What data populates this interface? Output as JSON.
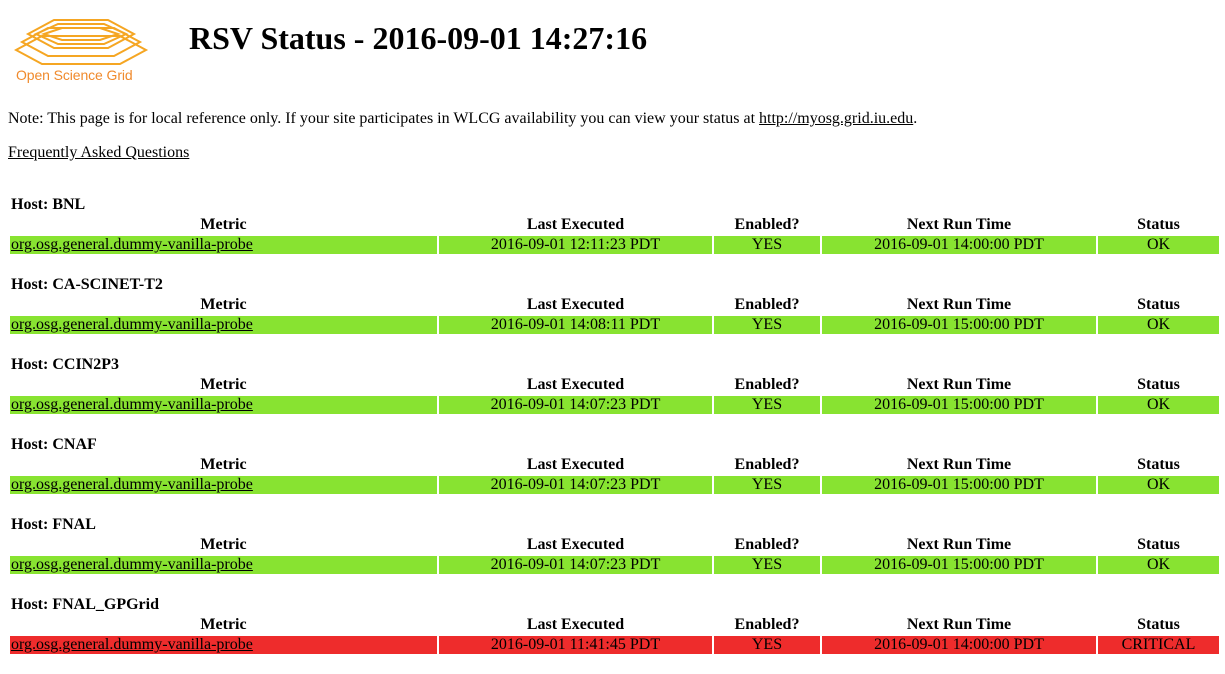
{
  "logo": {
    "text": "Open Science Grid",
    "color": "#f08a2c"
  },
  "page": {
    "title": "RSV Status - 2016-09-01 14:27:16"
  },
  "note": {
    "prefix": "Note: This page is for local reference only. If your site participates in WLCG availability you can view your status at ",
    "link_text": "http://myosg.grid.iu.edu",
    "suffix": "."
  },
  "faq": {
    "link_text": "Frequently Asked Questions"
  },
  "table_headers": {
    "metric": "Metric",
    "last_executed": "Last Executed",
    "enabled": "Enabled?",
    "next_run": "Next Run Time",
    "status": "Status"
  },
  "status_colors": {
    "OK": "#88e331",
    "CRITICAL": "#ee2c2c"
  },
  "hosts": [
    {
      "label": "Host: BNL",
      "metric": "org.osg.general.dummy-vanilla-probe",
      "last_executed": "2016-09-01 12:11:23 PDT",
      "enabled": "YES",
      "next_run": "2016-09-01 14:00:00 PDT",
      "status": "OK"
    },
    {
      "label": "Host: CA-SCINET-T2",
      "metric": "org.osg.general.dummy-vanilla-probe",
      "last_executed": "2016-09-01 14:08:11 PDT",
      "enabled": "YES",
      "next_run": "2016-09-01 15:00:00 PDT",
      "status": "OK"
    },
    {
      "label": "Host: CCIN2P3",
      "metric": "org.osg.general.dummy-vanilla-probe",
      "last_executed": "2016-09-01 14:07:23 PDT",
      "enabled": "YES",
      "next_run": "2016-09-01 15:00:00 PDT",
      "status": "OK"
    },
    {
      "label": "Host: CNAF",
      "metric": "org.osg.general.dummy-vanilla-probe",
      "last_executed": "2016-09-01 14:07:23 PDT",
      "enabled": "YES",
      "next_run": "2016-09-01 15:00:00 PDT",
      "status": "OK"
    },
    {
      "label": "Host: FNAL",
      "metric": "org.osg.general.dummy-vanilla-probe",
      "last_executed": "2016-09-01 14:07:23 PDT",
      "enabled": "YES",
      "next_run": "2016-09-01 15:00:00 PDT",
      "status": "OK"
    },
    {
      "label": "Host: FNAL_GPGrid",
      "metric": "org.osg.general.dummy-vanilla-probe",
      "last_executed": "2016-09-01 11:41:45 PDT",
      "enabled": "YES",
      "next_run": "2016-09-01 14:00:00 PDT",
      "status": "CRITICAL"
    }
  ]
}
